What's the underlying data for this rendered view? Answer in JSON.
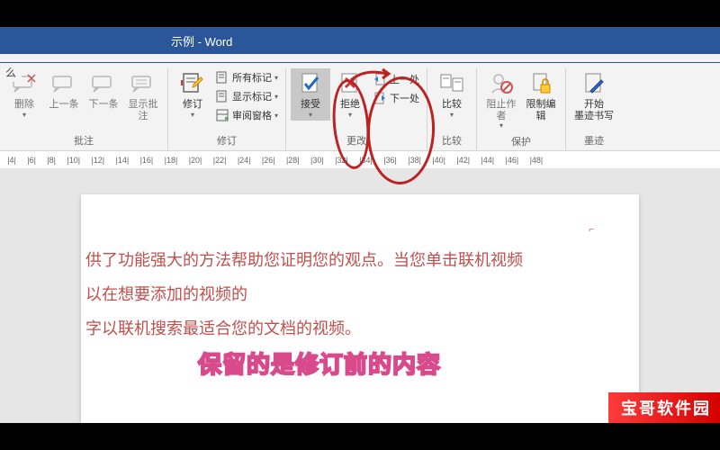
{
  "titlebar": {
    "title": "示例  -  Word"
  },
  "ribbon_tab_fragment": "么",
  "groups": {
    "comments": {
      "label": "批注",
      "btn_delete": "删除",
      "btn_prev": "上一条",
      "btn_next": "下一条",
      "btn_show": "显示批注"
    },
    "tracking": {
      "label": "修订",
      "btn_track": "修订",
      "opt_all_markup": "所有标记",
      "opt_show_markup": "显示标记",
      "opt_reviewing_pane": "审阅窗格"
    },
    "changes": {
      "label": "更改",
      "btn_accept": "接受",
      "btn_reject": "拒绝",
      "btn_prev": "上一处",
      "btn_next": "下一处"
    },
    "compare": {
      "label": "比较",
      "btn_compare": "比较"
    },
    "protect": {
      "label": "保护",
      "btn_block_authors": "阻止作者",
      "btn_restrict": "限制编辑"
    },
    "ink": {
      "label": "墨迹",
      "btn_start_ink": "开始\n墨迹书写"
    }
  },
  "ruler": [
    "|4|",
    "|6|",
    "|8|",
    "|10|",
    "|12|",
    "|14|",
    "|16|",
    "|18|",
    "|20|",
    "|22|",
    "|24|",
    "|26|",
    "|28|",
    "|30|",
    "|32|",
    "|34|",
    "|36|",
    "|38|",
    "|40|",
    "|42|",
    "|44|",
    "|46|",
    "|48|"
  ],
  "document": {
    "line1": "供了功能强大的方法帮助您证明您的观点。当您单击联机视频",
    "line2": "以在想要添加的视频的",
    "line3": "字以联机搜索最适合您的文档的视频。"
  },
  "annotation_caption": "保留的是修订前的内容",
  "watermark": "宝哥软件园"
}
